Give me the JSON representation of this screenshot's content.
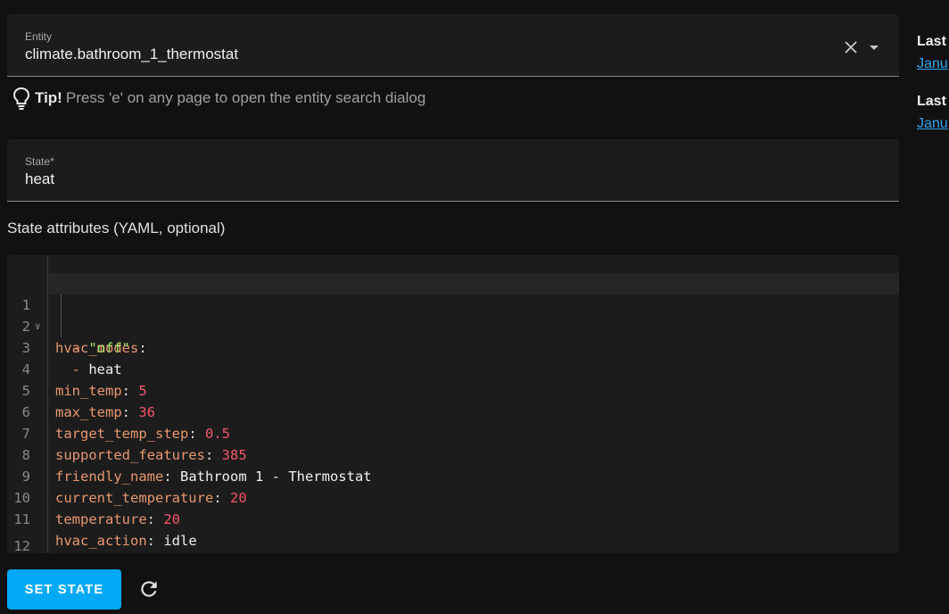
{
  "entity_field": {
    "label": "Entity",
    "value": "climate.bathroom_1_thermostat"
  },
  "tip": {
    "strong": "Tip!",
    "text": "Press 'e' on any page to open the entity search dialog"
  },
  "state_field": {
    "label": "State*",
    "value": "heat"
  },
  "attributes_label": "State attributes (YAML, optional)",
  "editor": {
    "line_numbers": [
      "1",
      "2",
      "3",
      "4",
      "5",
      "6",
      "7",
      "8",
      "9",
      "10",
      "11",
      "12"
    ],
    "lines": {
      "l1": {
        "key": "hvac_modes",
        "punct": ":"
      },
      "l2": {
        "dash": "- ",
        "value": "\"off\""
      },
      "l3": {
        "dash": "- ",
        "value": "heat"
      },
      "l4": {
        "key": "min_temp",
        "punct": ": ",
        "value": "5"
      },
      "l5": {
        "key": "max_temp",
        "punct": ": ",
        "value": "36"
      },
      "l6": {
        "key": "target_temp_step",
        "punct": ": ",
        "value": "0.5"
      },
      "l7": {
        "key": "supported_features",
        "punct": ": ",
        "value": "385"
      },
      "l8": {
        "key": "friendly_name",
        "punct": ": ",
        "value": "Bathroom 1 - Thermostat"
      },
      "l9": {
        "key": "current_temperature",
        "punct": ": ",
        "value": "20"
      },
      "l10": {
        "key": "temperature",
        "punct": ": ",
        "value": "20"
      },
      "l11": {
        "key": "hvac_action",
        "punct": ": ",
        "value": "idle"
      }
    }
  },
  "buttons": {
    "set_state": "SET STATE"
  },
  "side": {
    "label1": "Last",
    "link1": "Janu",
    "label2": "Last",
    "link2": "Janu"
  },
  "colors": {
    "accent": "#03a9f4",
    "yaml_key": "#e8976f",
    "yaml_number": "#f2566b",
    "yaml_string": "#a6e36d"
  },
  "icons": [
    "close-icon",
    "chevron-down-icon",
    "lightbulb-icon",
    "fold-chevron-icon",
    "refresh-icon"
  ]
}
